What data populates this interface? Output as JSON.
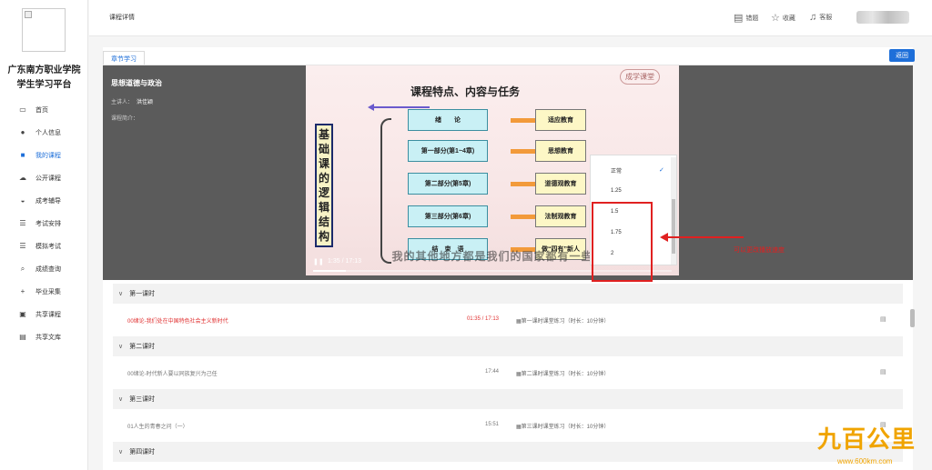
{
  "sidebar": {
    "school_line1": "广东南方职业学院",
    "school_line2": "学生学习平台",
    "items": [
      {
        "label": "首页",
        "icon": "monitor-icon"
      },
      {
        "label": "个人信息",
        "icon": "user-icon"
      },
      {
        "label": "我的课程",
        "icon": "book-icon",
        "active": true
      },
      {
        "label": "公开课程",
        "icon": "cloud-icon"
      },
      {
        "label": "成考辅导",
        "icon": "cap-icon"
      },
      {
        "label": "考试安排",
        "icon": "list-icon"
      },
      {
        "label": "模拟考试",
        "icon": "list-icon"
      },
      {
        "label": "成绩查询",
        "icon": "search-icon"
      },
      {
        "label": "毕业采集",
        "icon": "plus-icon"
      },
      {
        "label": "共享课程",
        "icon": "share-icon"
      },
      {
        "label": "共享文库",
        "icon": "doc-icon"
      }
    ]
  },
  "header": {
    "title": "课程详情",
    "actions": [
      {
        "label": "错题",
        "icon": "note-icon"
      },
      {
        "label": "收藏",
        "icon": "star-icon"
      },
      {
        "label": "客服",
        "icon": "headset-icon"
      }
    ]
  },
  "content": {
    "tab_label": "章节学习",
    "back_label": "返回",
    "course_name": "思想道德与政治",
    "lecturer_label": "主讲人：",
    "lecturer_value": "洪佳颖",
    "intro_label": "课程简介："
  },
  "video": {
    "slide_title": "课程特点、内容与任务",
    "slide_logo": "成学课堂",
    "vertical_chars": [
      "基",
      "础",
      "课",
      "的",
      "逻",
      "辑",
      "结",
      "构"
    ],
    "parts": [
      "绪　　论",
      "第一部分(第1~4章)",
      "第二部分(第5章)",
      "第三部分(第6章)",
      "结　束　语"
    ],
    "edu": [
      "适应教育",
      "思想教育",
      "道德观教育",
      "法制观教育",
      "做“四有”新人"
    ],
    "subtitle": "我的其他地方都是我们的国家都有一些",
    "time": "1:35 / 17:13",
    "progress": 0.092,
    "speed_options": [
      "正常",
      "1.25",
      "1.5",
      "1.75",
      "2"
    ],
    "selected_speed": "正常",
    "annotation": "可以更改播放速度"
  },
  "chapters": [
    {
      "title": "第一课时",
      "lesson": "00绪论-我们处在中国特色社会主义新时代",
      "duration": "01:35 / 17:13",
      "exercise": "第一课时课堂练习（时长：10分钟）",
      "active": true
    },
    {
      "title": "第二课时",
      "lesson": "00绪论-时代新人要以同族复兴为己任",
      "duration": "17:44",
      "exercise": "第二课时课堂练习（时长：10分钟）",
      "active": false
    },
    {
      "title": "第三课时",
      "lesson": "01人生的青春之问（一）",
      "duration": "15:51",
      "exercise": "第三课时课堂练习（时长：10分钟）",
      "active": false
    },
    {
      "title": "第四课时"
    }
  ],
  "watermark": {
    "main": "九百公里",
    "url": "www.600km.com"
  }
}
